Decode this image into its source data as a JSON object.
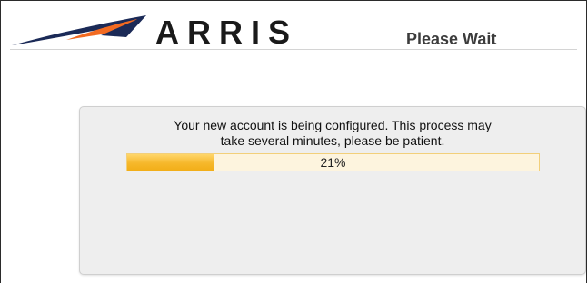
{
  "header": {
    "brand": "ARRIS",
    "title": "Please Wait"
  },
  "panel": {
    "message_line1": "Your new account is being configured. This process may",
    "message_line2": "take several minutes, please be patient."
  },
  "progress": {
    "percent": 21,
    "label": "21%"
  },
  "colors": {
    "logo_navy": "#1b2a57",
    "logo_orange": "#f26a21",
    "progress_fill": "#f6b82b",
    "progress_track": "#fdf4de"
  }
}
